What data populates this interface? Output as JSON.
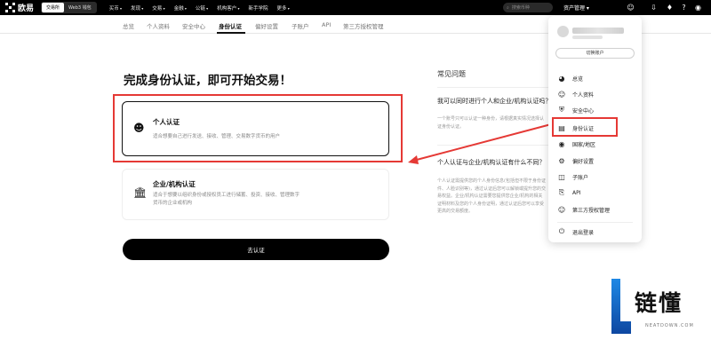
{
  "topbar": {
    "logo_text": "欧易",
    "mode_exchange": "交易所",
    "mode_web3": "Web3 钱包",
    "nav": [
      "买币",
      "发现",
      "交易",
      "金融",
      "公链",
      "机构客户",
      "新手学院",
      "更多"
    ],
    "search_placeholder": "搜索币种",
    "asset_label": "资产管理"
  },
  "subnav": {
    "items": [
      "总览",
      "个人资料",
      "安全中心",
      "身份认证",
      "偏好设置",
      "子账户",
      "API",
      "第三方授权管理"
    ],
    "active_index": 3
  },
  "main": {
    "heading": "完成身份认证，即可开始交易！",
    "personal": {
      "title": "个人认证",
      "desc": "适合想要自己进行发送、接收、管理、交易数字货币的用户"
    },
    "institution": {
      "title": "企业/机构认证",
      "desc": "适合于想要以组织身份或授权员工进行储蓄、投资、接收、管理数字货币的企业或机构"
    },
    "cta": "去认证"
  },
  "faq": {
    "title": "常见问题",
    "q1": "我可以同时进行个人和企业/机构认证吗？",
    "a1": "一个账号只可以认证一种身份，请根据真实情况选择认证身份认证。",
    "q2": "个人认证与企业/机构认证有什么不同？",
    "a2": "个人认证需提供您的个人身份信息(包括但不限于身份证件、人脸识别等)，通过认证后您可以解锁或提升您的交易权益。企业/机构认证需要您提供您企业/机构的相关证明材料及您的个人身份证明，通过认证后您可以享受更高的交易额度。"
  },
  "dropdown": {
    "switch_account": "切换账户",
    "items": [
      {
        "label": "总览",
        "icon": "gauge-icon"
      },
      {
        "label": "个人资料",
        "icon": "user-icon"
      },
      {
        "label": "安全中心",
        "icon": "shield-icon"
      },
      {
        "label": "身份认证",
        "icon": "id-card-icon"
      },
      {
        "label": "国家/地区",
        "icon": "globe-icon"
      },
      {
        "label": "偏好设置",
        "icon": "gear-icon"
      },
      {
        "label": "子账户",
        "icon": "sub-account-icon"
      },
      {
        "label": "API",
        "icon": "api-icon"
      },
      {
        "label": "第三方授权管理",
        "icon": "third-party-icon"
      }
    ],
    "logout": "退出登录"
  },
  "watermark": {
    "text": "链懂",
    "sub": "NEATDOWN.COM"
  },
  "colors": {
    "highlight": "#e53935",
    "primary": "#000000"
  }
}
